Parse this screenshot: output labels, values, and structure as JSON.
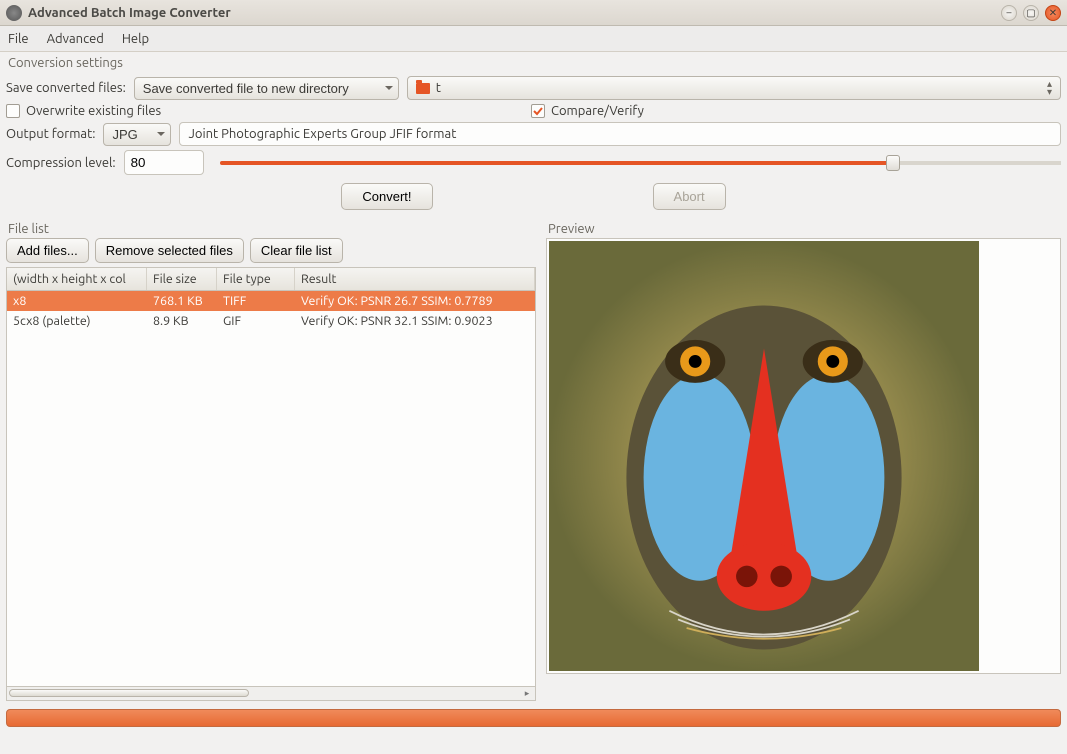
{
  "window": {
    "title": "Advanced Batch Image Converter"
  },
  "menu": {
    "file": "File",
    "advanced": "Advanced",
    "help": "Help"
  },
  "settings": {
    "heading": "Conversion settings",
    "save_label": "Save converted files:",
    "save_mode": "Save converted file to new directory",
    "dir_name": "t",
    "overwrite_label": "Overwrite existing files",
    "compare_label": "Compare/Verify",
    "output_format_label": "Output format:",
    "output_format": "JPG",
    "format_desc": "Joint Photographic Experts Group JFIF format",
    "compression_label": "Compression level:",
    "compression_value": "80",
    "convert_btn": "Convert!",
    "abort_btn": "Abort"
  },
  "filelist": {
    "heading": "File list",
    "add_btn": "Add files...",
    "remove_btn": "Remove selected files",
    "clear_btn": "Clear file list",
    "columns": {
      "dims": "(width x height x col",
      "size": "File size",
      "type": "File type",
      "result": "Result"
    },
    "rows": [
      {
        "dims": "x8",
        "size": "768.1 KB",
        "type": "TIFF",
        "result": "Verify OK: PSNR 26.7 SSIM: 0.7789",
        "selected": true
      },
      {
        "dims": "5cx8 (palette)",
        "size": "8.9 KB",
        "type": "GIF",
        "result": "Verify OK: PSNR 32.1 SSIM: 0.9023",
        "selected": false
      }
    ]
  },
  "preview": {
    "heading": "Preview"
  }
}
